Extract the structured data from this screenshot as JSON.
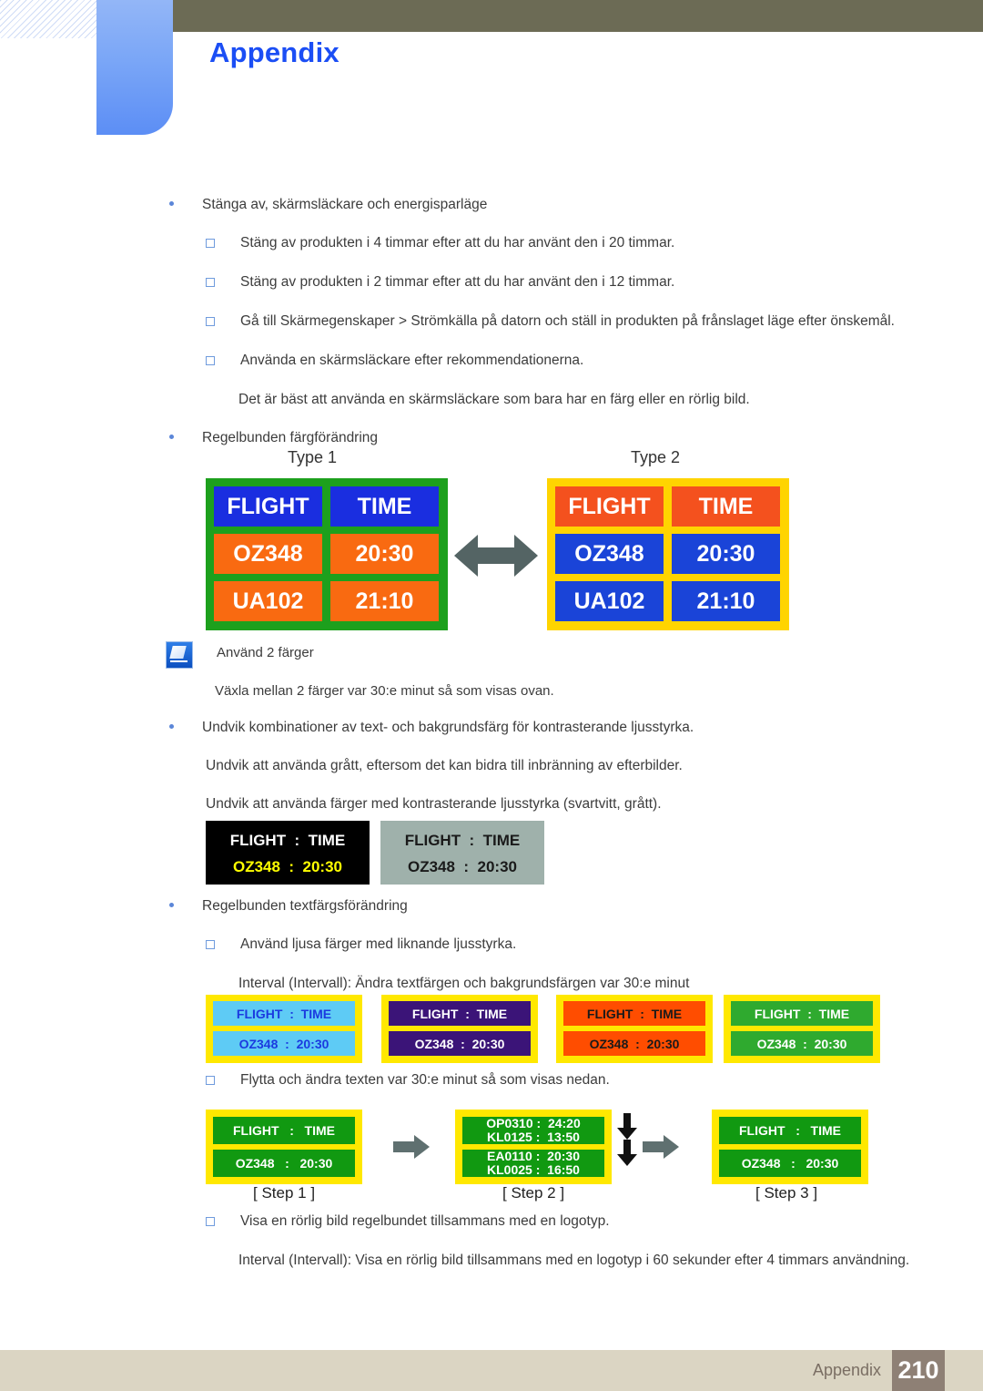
{
  "header": {
    "title": "Appendix",
    "accent_blue": "#1b4ef5",
    "bar_color": "#6c6b55"
  },
  "body_items": [
    {
      "level": 1,
      "text": "Stänga av, skärmsläckare och energisparläge"
    },
    {
      "level": 2,
      "text": "Stäng av produkten i 4 timmar efter att du har använt den i 20 timmar."
    },
    {
      "level": 2,
      "text": "Stäng av produkten i 2 timmar efter att du har använt den i 12 timmar."
    },
    {
      "level": 2,
      "text": "Gå till Skärmegenskaper > Strömkälla på datorn och ställ in produkten på frånslaget läge efter önskemål."
    },
    {
      "level": 2,
      "text": "Använda en skärmsläckare efter rekommendationerna."
    },
    {
      "level": 0,
      "text": "Det är bäst att använda en skärmsläckare som bara har en färg eller en rörlig bild."
    },
    {
      "level": 1,
      "text": "Regelbunden färgförändring"
    }
  ],
  "type_boards": {
    "label_1": "Type 1",
    "label_2": "Type 2",
    "rows": [
      {
        "left": "FLIGHT",
        "right": "TIME"
      },
      {
        "left": "OZ348",
        "right": "20:30"
      },
      {
        "left": "UA102",
        "right": "21:10"
      }
    ],
    "type1_colors": {
      "border": "#1da01d",
      "header": "#1a2ee0",
      "data": "#f96a11",
      "text": "#ffffff"
    },
    "type2_colors": {
      "border": "#ffd400",
      "header": "#f4511e",
      "data": "#1a44d8",
      "text": "#ffffff"
    },
    "arrow_color": "#546464"
  },
  "note": {
    "title": "Använd 2 färger",
    "text": "Växla mellan 2 färger var 30:e minut så som visas ovan."
  },
  "body_items_2": [
    {
      "level": 1,
      "text": "Undvik kombinationer av text- och bakgrundsfärg för kontrasterande ljusstyrka."
    },
    {
      "level": 0,
      "text": "Undvik att använda grått, eftersom det kan bidra till inbränning av efterbilder."
    },
    {
      "level": 0,
      "text": "Undvik att använda färger med kontrasterande ljusstyrka (svartvitt, grått)."
    }
  ],
  "contrast_boards": [
    {
      "name": "black-board",
      "background": "#000000",
      "line1": "FLIGHT  :  TIME",
      "line1_color": "#ffffff",
      "line2": "OZ348  :  20:30",
      "line2_color": "#ffff00"
    },
    {
      "name": "gray-board",
      "background": "#9fb1ab",
      "line1": "FLIGHT  :  TIME",
      "line1_color": "#1a1a1a",
      "line2": "OZ348  :  20:30",
      "line2_color": "#1a1a1a"
    }
  ],
  "body_items_3": [
    {
      "level": 1,
      "text": "Regelbunden textfärgsförändring"
    },
    {
      "level": 2,
      "text": "Använd ljusa färger med liknande ljusstyrka."
    },
    {
      "level": 0,
      "text": "Interval (Intervall): Ändra textfärgen och bakgrundsfärgen var 30:e minut"
    }
  ],
  "color_panels": {
    "outer_background": "#ffe800",
    "line1": "FLIGHT  :  TIME",
    "line2": "OZ348  :  20:30",
    "panels": [
      {
        "name": "panel-lightblue",
        "band": "#5ecbf5",
        "text": "#1b3ae0"
      },
      {
        "name": "panel-purple",
        "band": "#3b1478",
        "text": "#ffffff"
      },
      {
        "name": "panel-orange",
        "band": "#ff4d00",
        "text": "#1a1a1a"
      },
      {
        "name": "panel-green",
        "band": "#2faa2f",
        "text": "#ffffff"
      }
    ]
  },
  "move_text": {
    "level": 2,
    "text": "Flytta och ändra texten var 30:e minut så som visas nedan."
  },
  "steps": {
    "outer_background": "#ffe800",
    "band_color": "#119911",
    "step1": {
      "label": "[ Step  1 ]",
      "line1": "FLIGHT   :   TIME",
      "line2": "OZ348   :   20:30"
    },
    "step2": {
      "label": "[ Step  2 ]",
      "band1_top": "OP0310 :  24:20",
      "band1_bottom": "KL0125 :  13:50",
      "band2_top": "EA0110 :  20:30",
      "band2_bottom": "KL0025 :  16:50"
    },
    "step3": {
      "label": "[ Step  3 ]",
      "line1": "FLIGHT   :   TIME",
      "line2": "OZ348   :   20:30"
    },
    "arrow_color": "#5f7070"
  },
  "body_items_4": [
    {
      "level": 2,
      "text": "Visa en rörlig bild regelbundet tillsammans med en logotyp."
    },
    {
      "level": 0,
      "text": "Interval (Intervall): Visa en rörlig bild tillsammans med en logotyp i 60 sekunder efter 4 timmars användning."
    }
  ],
  "footer": {
    "label": "Appendix",
    "page": "210",
    "bar_color": "#dbd5c3",
    "page_box_color": "#8e8075"
  }
}
